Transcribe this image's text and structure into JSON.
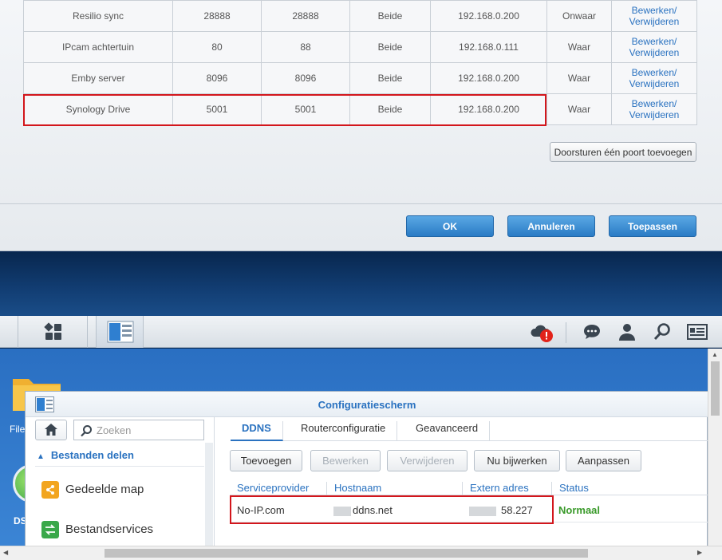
{
  "port_forwarding": {
    "rows": [
      {
        "name": "Resilio sync",
        "public_port": "28888",
        "private_port": "28888",
        "protocol": "Beide",
        "ip": "192.168.0.200",
        "enabled": "Onwaar",
        "action_edit": "Bewerken/",
        "action_delete": "Verwijderen"
      },
      {
        "name": "IPcam achtertuin",
        "public_port": "80",
        "private_port": "88",
        "protocol": "Beide",
        "ip": "192.168.0.111",
        "enabled": "Waar",
        "action_edit": "Bewerken/",
        "action_delete": "Verwijderen"
      },
      {
        "name": "Emby server",
        "public_port": "8096",
        "private_port": "8096",
        "protocol": "Beide",
        "ip": "192.168.0.200",
        "enabled": "Waar",
        "action_edit": "Bewerken/",
        "action_delete": "Verwijderen"
      },
      {
        "name": "Synology Drive",
        "public_port": "5001",
        "private_port": "5001",
        "protocol": "Beide",
        "ip": "192.168.0.200",
        "enabled": "Waar",
        "action_edit": "Bewerken/",
        "action_delete": "Verwijderen"
      }
    ],
    "add_port_label": "Doorsturen één poort toevoegen",
    "ok_label": "OK",
    "cancel_label": "Annuleren",
    "apply_label": "Toepassen"
  },
  "taskbar": {
    "icons": [
      "main-menu-icon",
      "control-panel-icon",
      "cloud-alert-icon",
      "chat-icon",
      "user-icon",
      "search-icon",
      "widgets-icon"
    ],
    "alert_badge": "!"
  },
  "desktop": {
    "file_label": "File",
    "ds_label": "DS"
  },
  "control_panel": {
    "title": "Configuratiescherm",
    "search_placeholder": "Zoeken",
    "section_label": "Bestanden delen",
    "sidebar_items": [
      {
        "label": "Gedeelde map",
        "icon": "shared-folder-icon"
      },
      {
        "label": "Bestandservices",
        "icon": "file-services-icon"
      }
    ],
    "tabs": [
      "DDNS",
      "Routerconfiguratie",
      "Geavanceerd"
    ],
    "toolbar": [
      "Toevoegen",
      "Bewerken",
      "Verwijderen",
      "Nu bijwerken",
      "Aanpassen"
    ],
    "ddns_columns": [
      "Serviceprovider",
      "Hostnaam",
      "Extern adres",
      "Status"
    ],
    "ddns_row": {
      "provider": "No-IP.com",
      "hostname": "ddns.net",
      "external_address": "58.227",
      "status": "Normaal"
    }
  },
  "colors": {
    "accent": "#2a72c0",
    "highlight": "#d3161c",
    "status_ok": "#3a9a2a"
  }
}
